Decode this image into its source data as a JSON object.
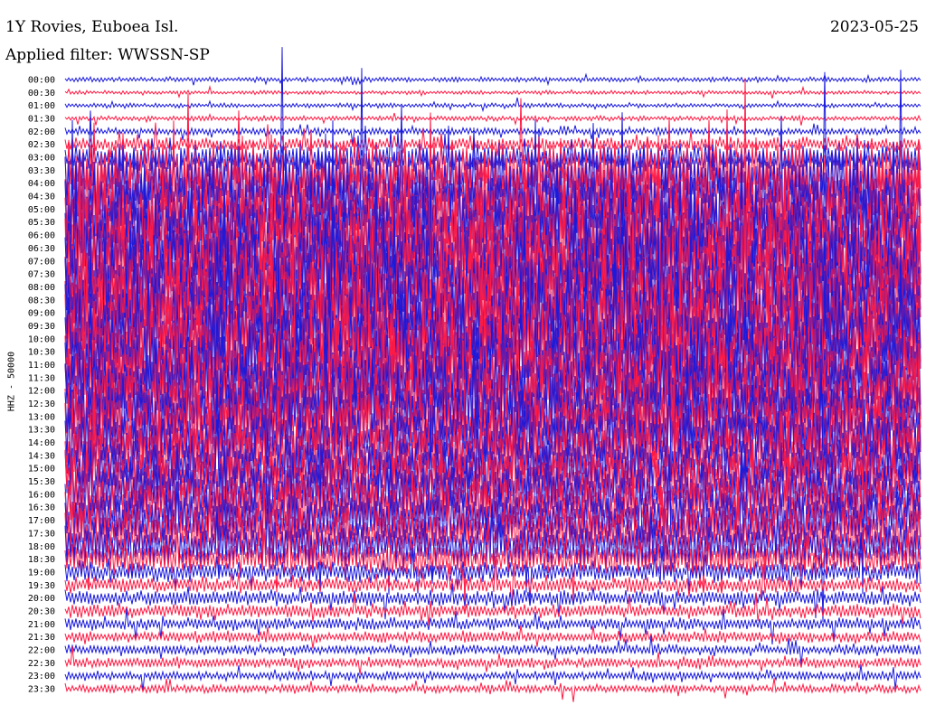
{
  "header": {
    "station": "1Y Rovies, Euboea Isl.",
    "date": "2023-05-25",
    "filter": "Applied filter: WWSSN-SP"
  },
  "chart_data": {
    "type": "line",
    "title": "1Y Rovies, Euboea Isl.",
    "subtitle": "Applied filter: WWSSN-SP",
    "date": "2023-05-25",
    "ylabel": "HHZ - 50000",
    "xlabel": "",
    "y_tick_labels": [
      "00:00",
      "00:30",
      "01:00",
      "01:30",
      "02:00",
      "02:30",
      "03:00",
      "03:30",
      "04:00",
      "04:30",
      "05:00",
      "05:30",
      "06:00",
      "06:30",
      "07:00",
      "07:30",
      "08:00",
      "08:30",
      "09:00",
      "09:30",
      "10:00",
      "10:30",
      "11:00",
      "11:30",
      "12:00",
      "12:30",
      "13:00",
      "13:30",
      "14:00",
      "14:30",
      "15:00",
      "15:30",
      "16:00",
      "16:30",
      "17:00",
      "17:30",
      "18:00",
      "18:30",
      "19:00",
      "19:30",
      "20:00",
      "20:30",
      "21:00",
      "21:30",
      "22:00",
      "22:30",
      "23:00",
      "23:30"
    ],
    "trace_colors": [
      "#1a1adc",
      "#ff1a44"
    ],
    "line_duration_minutes": 30,
    "amplitude_envelope": [
      0.22,
      0.17,
      0.2,
      0.22,
      0.3,
      0.6,
      1.2,
      2.6,
      3.2,
      3.4,
      3.6,
      3.8,
      4.0,
      4.0,
      4.0,
      4.0,
      4.0,
      4.0,
      4.0,
      4.0,
      3.9,
      3.8,
      3.8,
      3.8,
      3.8,
      3.6,
      3.4,
      3.2,
      3.0,
      2.8,
      2.7,
      2.6,
      2.6,
      2.5,
      2.4,
      2.2,
      1.9,
      1.4,
      0.9,
      0.7,
      0.7,
      0.6,
      0.55,
      0.5,
      0.45,
      0.45,
      0.4,
      0.35
    ],
    "grid": false,
    "legend": "none"
  }
}
